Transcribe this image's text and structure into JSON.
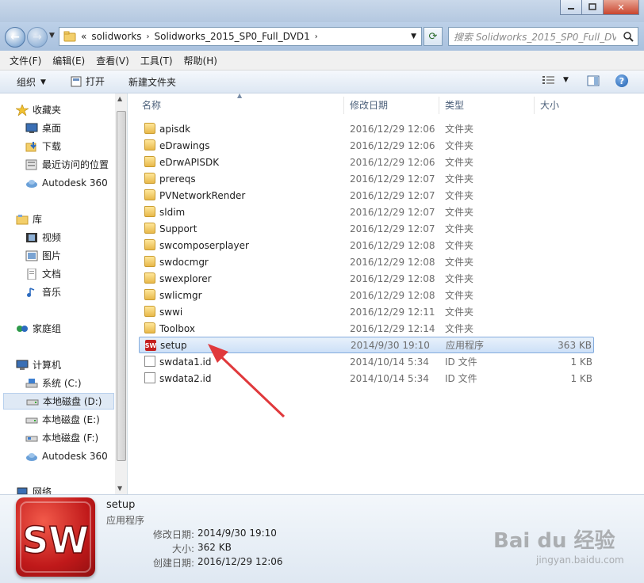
{
  "window": {
    "minimize": "",
    "maximize": "",
    "close": "✕"
  },
  "address": {
    "chevron": "«",
    "crumbs": [
      "solidworks",
      "Solidworks_2015_SP0_Full_DVD1"
    ],
    "search_placeholder": "搜索 Solidworks_2015_SP0_Full_DV..."
  },
  "menu": [
    "文件(F)",
    "编辑(E)",
    "查看(V)",
    "工具(T)",
    "帮助(H)"
  ],
  "toolbar": {
    "organize": "组织",
    "open": "打开",
    "new_folder": "新建文件夹"
  },
  "nav": {
    "favorites": {
      "label": "收藏夹",
      "items": [
        "桌面",
        "下载",
        "最近访问的位置",
        "Autodesk 360"
      ]
    },
    "libraries": {
      "label": "库",
      "items": [
        "视频",
        "图片",
        "文档",
        "音乐"
      ]
    },
    "homegroup": "家庭组",
    "computer": {
      "label": "计算机",
      "items": [
        "系统 (C:)",
        "本地磁盘 (D:)",
        "本地磁盘 (E:)",
        "本地磁盘 (F:)",
        "Autodesk 360"
      ]
    },
    "network": "网络"
  },
  "columns": {
    "name": "名称",
    "date": "修改日期",
    "type": "类型",
    "size": "大小"
  },
  "files": [
    {
      "name": "apisdk",
      "date": "2016/12/29 12:06",
      "type": "文件夹",
      "size": "",
      "icon": "folder"
    },
    {
      "name": "eDrawings",
      "date": "2016/12/29 12:06",
      "type": "文件夹",
      "size": "",
      "icon": "folder"
    },
    {
      "name": "eDrwAPISDK",
      "date": "2016/12/29 12:06",
      "type": "文件夹",
      "size": "",
      "icon": "folder"
    },
    {
      "name": "prereqs",
      "date": "2016/12/29 12:07",
      "type": "文件夹",
      "size": "",
      "icon": "folder"
    },
    {
      "name": "PVNetworkRender",
      "date": "2016/12/29 12:07",
      "type": "文件夹",
      "size": "",
      "icon": "folder"
    },
    {
      "name": "sldim",
      "date": "2016/12/29 12:07",
      "type": "文件夹",
      "size": "",
      "icon": "folder"
    },
    {
      "name": "Support",
      "date": "2016/12/29 12:07",
      "type": "文件夹",
      "size": "",
      "icon": "folder"
    },
    {
      "name": "swcomposerplayer",
      "date": "2016/12/29 12:08",
      "type": "文件夹",
      "size": "",
      "icon": "folder"
    },
    {
      "name": "swdocmgr",
      "date": "2016/12/29 12:08",
      "type": "文件夹",
      "size": "",
      "icon": "folder"
    },
    {
      "name": "swexplorer",
      "date": "2016/12/29 12:08",
      "type": "文件夹",
      "size": "",
      "icon": "folder"
    },
    {
      "name": "swlicmgr",
      "date": "2016/12/29 12:08",
      "type": "文件夹",
      "size": "",
      "icon": "folder"
    },
    {
      "name": "swwi",
      "date": "2016/12/29 12:11",
      "type": "文件夹",
      "size": "",
      "icon": "folder"
    },
    {
      "name": "Toolbox",
      "date": "2016/12/29 12:14",
      "type": "文件夹",
      "size": "",
      "icon": "folder"
    },
    {
      "name": "setup",
      "date": "2014/9/30 19:10",
      "type": "应用程序",
      "size": "363 KB",
      "icon": "solidworks"
    },
    {
      "name": "swdata1.id",
      "date": "2014/10/14 5:34",
      "type": "ID 文件",
      "size": "1 KB",
      "icon": "document"
    },
    {
      "name": "swdata2.id",
      "date": "2014/10/14 5:34",
      "type": "ID 文件",
      "size": "1 KB",
      "icon": "document"
    }
  ],
  "details": {
    "name": "setup",
    "type": "应用程序",
    "modified_label": "修改日期:",
    "modified": "2014/9/30 19:10",
    "size_label": "大小:",
    "size": "362 KB",
    "created_label": "创建日期:",
    "created": "2016/12/29 12:06"
  },
  "watermark": {
    "brand": "Bai du 经验",
    "url": "jingyan.baidu.com"
  },
  "colors": {
    "annotation_arrow": "#e0393c",
    "selection": "#cde0f7"
  }
}
